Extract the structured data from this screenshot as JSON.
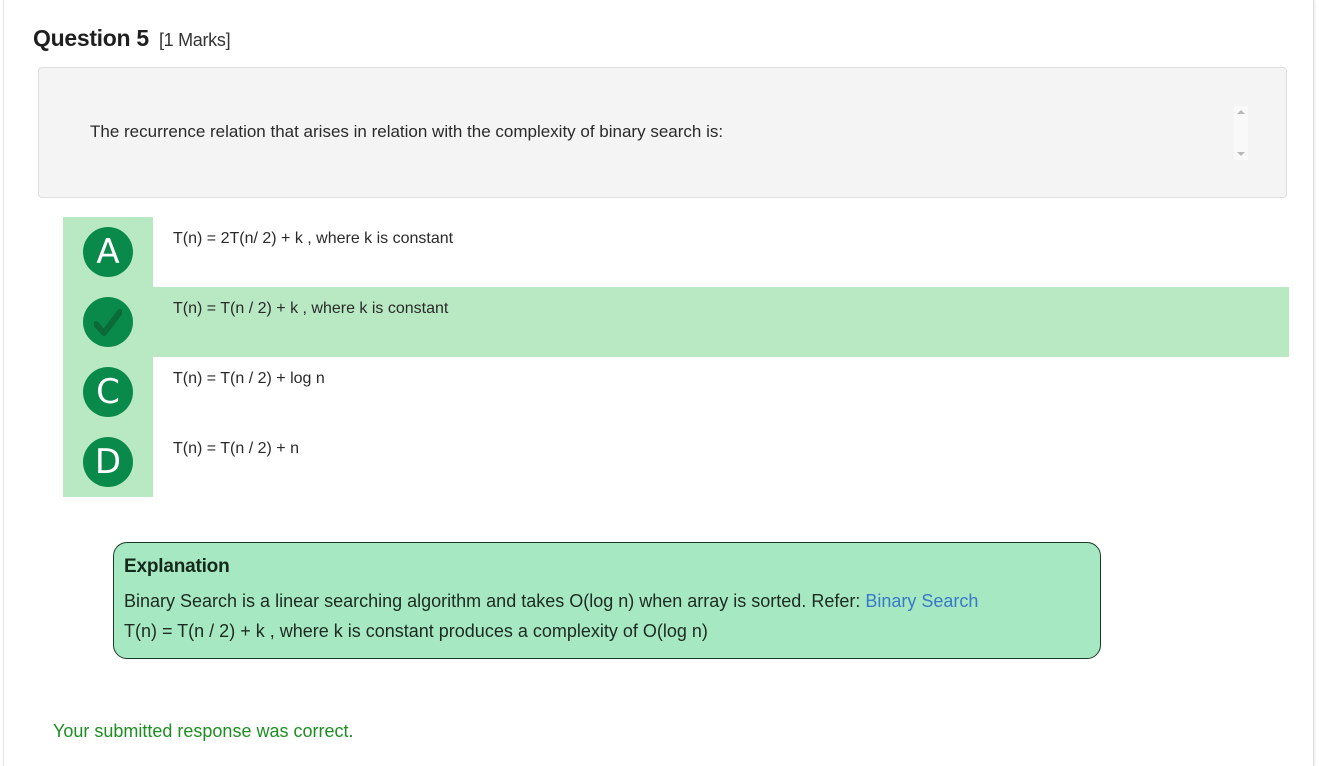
{
  "question": {
    "title": "Question 5",
    "marks": "[1 Marks]",
    "text": "The recurrence relation that arises in relation with the complexity of binary search is:"
  },
  "options": [
    {
      "letter": "A",
      "text": "T(n) = 2T(n/ 2) + k , where k is constant",
      "correct": false
    },
    {
      "letter": "B",
      "text": "T(n) = T(n / 2) + k , where k is constant",
      "correct": true,
      "icon": "checkmark-icon"
    },
    {
      "letter": "C",
      "text": "T(n) = T(n / 2) + log n",
      "correct": false
    },
    {
      "letter": "D",
      "text": "T(n) = T(n / 2) + n",
      "correct": false
    }
  ],
  "explanation": {
    "title": "Explanation",
    "line1_prefix": "Binary Search is a linear searching algorithm and takes O(log n) when array is sorted. Refer: ",
    "link_text": "Binary Search",
    "line2": "T(n) = T(n / 2) + k , where k is constant produces a complexity of O(log n)"
  },
  "result_message": "Your submitted response was correct.",
  "colors": {
    "option_highlight": "#b8e9c3",
    "badge": "#0a8a4a",
    "explanation_bg": "#a6e8c2",
    "link": "#3a78c8",
    "result_text": "#1d8e22"
  }
}
